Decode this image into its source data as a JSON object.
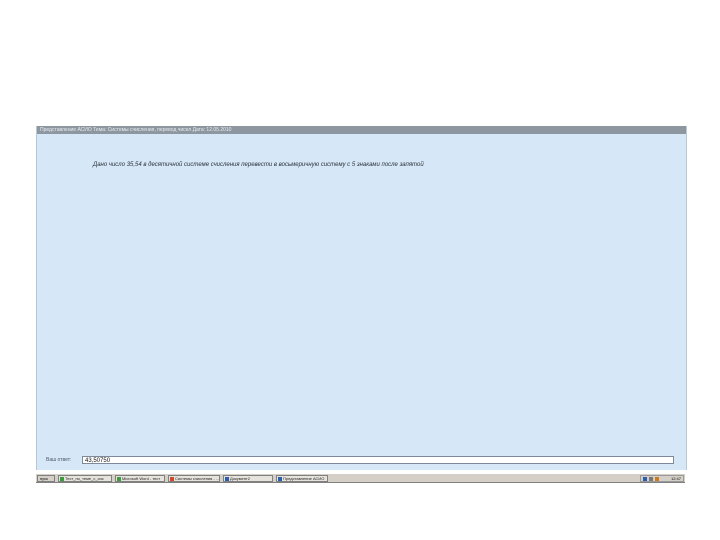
{
  "window": {
    "title": "Представление АСИО Тема: Системы счисления, перевод чисел Дата: 12.05.2010"
  },
  "task": {
    "text": "Дано число 35,54 в десятичной системе счисления перевести в восьмеричную систему с 5 знаками после запятой"
  },
  "answer": {
    "label": "Ваш ответ:",
    "value": "43,50750"
  },
  "taskbar": {
    "start_label": "пуск",
    "buttons": [
      {
        "label": "Тест_по_теме_с_сис",
        "icon_color": "#3a9c3a"
      },
      {
        "label": "Microsoft Word - тест",
        "icon_color": "#3a9c3a"
      },
      {
        "label": "Системы счисления - ...",
        "icon_color": "#d04a2a"
      },
      {
        "label": "Документ2",
        "icon_color": "#2a5fb0"
      },
      {
        "label": "Представление АСИО",
        "icon_color": "#2a5fb0"
      }
    ],
    "clock": "12:47"
  }
}
